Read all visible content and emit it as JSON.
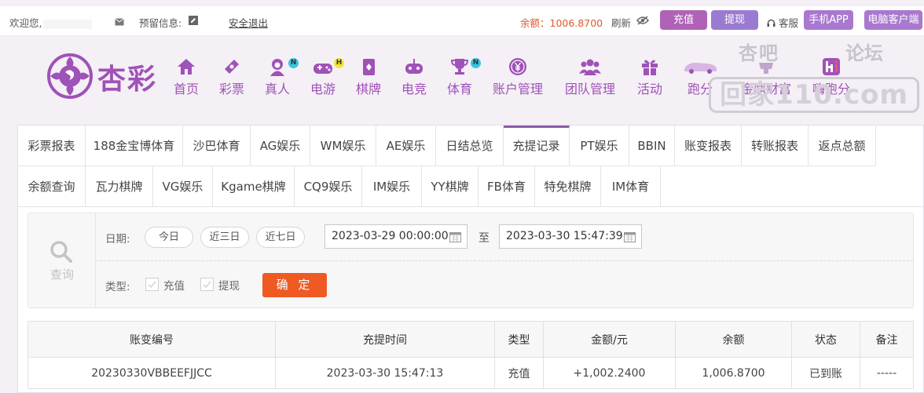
{
  "topbar": {
    "welcome": "欢迎您,",
    "reserved_info": "预留信息:",
    "logout": "安全退出",
    "balance": "余额：1006.8700",
    "refresh": "刷新",
    "recharge": "充值",
    "withdraw": "提现",
    "service": "客服",
    "mobile_app": "手机APP",
    "pc_client": "电脑客户端"
  },
  "logo": {
    "text": "杏彩"
  },
  "nav": [
    {
      "label": "首页",
      "icon": "home-icon"
    },
    {
      "label": "彩票",
      "icon": "lottery-ticket-icon"
    },
    {
      "label": "真人",
      "icon": "live-dealer-icon",
      "badge": "N"
    },
    {
      "label": "电游",
      "icon": "gamepad-icon",
      "badge": "H"
    },
    {
      "label": "棋牌",
      "icon": "cards-icon"
    },
    {
      "label": "电竞",
      "icon": "esports-controller-icon"
    },
    {
      "label": "体育",
      "icon": "trophy-icon",
      "badge": "N"
    },
    {
      "label": "账户管理",
      "icon": "account-yen-icon"
    },
    {
      "label": "团队管理",
      "icon": "team-icon"
    },
    {
      "label": "活动",
      "icon": "gift-icon"
    },
    {
      "label": "跑分",
      "icon": "car-icon"
    },
    {
      "label": "金鼎财富",
      "icon": "wealth-icon"
    },
    {
      "label": "嗨跑分",
      "icon": "hi-icon"
    }
  ],
  "watermark": {
    "top_left": "杏吧",
    "top_right": "论坛",
    "main": "回家110.com"
  },
  "tabs_row1": [
    "彩票报表",
    "188金宝博体育",
    "沙巴体育",
    "AG娱乐",
    "WM娱乐",
    "AE娱乐",
    "日结总览",
    "充提记录",
    "PT娱乐",
    "BBIN",
    "账变报表",
    "转账报表",
    "返点总额"
  ],
  "tabs_row2": [
    "余额查询",
    "瓦力棋牌",
    "VG娱乐",
    "Kgame棋牌",
    "CQ9娱乐",
    "IM娱乐",
    "YY棋牌",
    "FB体育",
    "特免棋牌",
    "IM体育"
  ],
  "active_tab": "充提记录",
  "filter": {
    "side_label": "查询",
    "date_label": "日期:",
    "quick": [
      "今日",
      "近三日",
      "近七日"
    ],
    "start": "2023-03-29 00:00:00",
    "to": "至",
    "end": "2023-03-30 15:47:39",
    "type_label": "类型:",
    "type_recharge": "充值",
    "type_withdraw": "提现",
    "confirm": "确 定"
  },
  "table": {
    "headers": [
      "账变编号",
      "充提时间",
      "类型",
      "金额/元",
      "余额",
      "状态",
      "备注"
    ],
    "rows": [
      [
        "20230330VBBEEFJJCC",
        "2023-03-30 15:47:13",
        "充值",
        "+1,002.2400",
        "1,006.8700",
        "已到账",
        "-----"
      ]
    ]
  },
  "colors": {
    "brand": "#9f52b7",
    "accent": "#ee5a22",
    "success": "#2bb62b",
    "amount": "#d2232a"
  }
}
